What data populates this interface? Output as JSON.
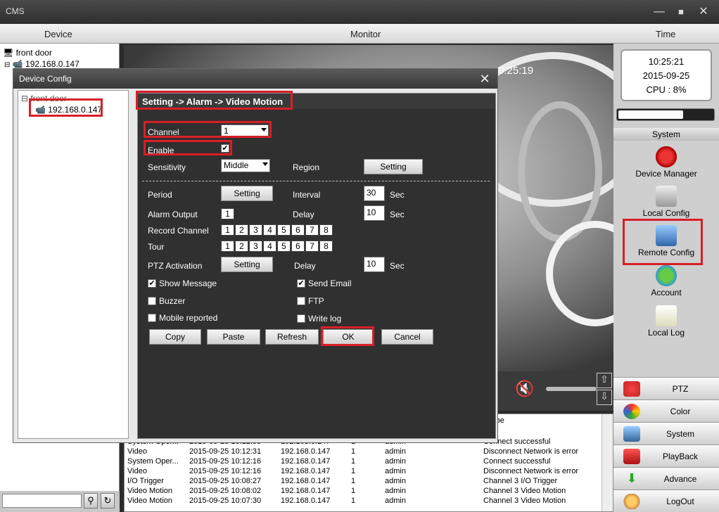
{
  "window": {
    "title": "CMS",
    "minimize": "—",
    "maximize": "■",
    "close": "✕"
  },
  "columns": {
    "device": "Device",
    "monitor": "Monitor",
    "time": "Time"
  },
  "device_tree": {
    "root": "front door",
    "child": "192.168.0.147"
  },
  "video": {
    "timestamp": "0:25:19"
  },
  "clock": {
    "time": "10:25:21",
    "date": "2015-09-25",
    "cpu": "CPU : 8%"
  },
  "system": {
    "header": "System",
    "items": [
      {
        "label": "Device Manager",
        "icon": "device-manager-icon"
      },
      {
        "label": "Local Config",
        "icon": "local-config-icon"
      },
      {
        "label": "Remote Config",
        "icon": "remote-config-icon"
      },
      {
        "label": "Account",
        "icon": "account-icon"
      },
      {
        "label": "Local Log",
        "icon": "local-log-icon"
      }
    ]
  },
  "bottom_menu": [
    {
      "label": "PTZ",
      "icon": "ptz-icon"
    },
    {
      "label": "Color",
      "icon": "color-icon"
    },
    {
      "label": "System",
      "icon": "system-icon"
    },
    {
      "label": "PlayBack",
      "icon": "playback-icon"
    },
    {
      "label": "Advance",
      "icon": "advance-icon"
    },
    {
      "label": "LogOut",
      "icon": "logout-icon"
    }
  ],
  "log": {
    "header_desc": "cribe",
    "rows": [
      [
        "System Oper...",
        "2015-09-25 10:12:55",
        "192.168.0.147",
        "1",
        "admin",
        "Connect successful"
      ],
      [
        "Video",
        "2015-09-25 10:12:31",
        "192.168.0.147",
        "1",
        "admin",
        "Disconnect Network is error"
      ],
      [
        "System Oper...",
        "2015-09-25 10:12:16",
        "192.168.0.147",
        "1",
        "admin",
        "Connect successful"
      ],
      [
        "Video",
        "2015-09-25 10:12:16",
        "192.168.0.147",
        "1",
        "admin",
        "Disconnect Network is error"
      ],
      [
        "I/O Trigger",
        "2015-09-25 10:08:27",
        "192.168.0.147",
        "1",
        "admin",
        "Channel 3 I/O Trigger"
      ],
      [
        "Video Motion",
        "2015-09-25 10:08:02",
        "192.168.0.147",
        "1",
        "admin",
        "Channel 3 Video Motion"
      ],
      [
        "Video Motion",
        "2015-09-25 10:07:30",
        "192.168.0.147",
        "1",
        "admin",
        "Channel 3 Video Motion"
      ]
    ]
  },
  "dialog": {
    "title": "Device Config",
    "close": "✕",
    "tree_root": "front door",
    "tree_child": "192.168.0.147",
    "breadcrumb": "Setting -> Alarm -> Video Motion",
    "channel_label": "Channel",
    "channel_value": "1",
    "enable_label": "Enable",
    "enable_checked": true,
    "sensitivity_label": "Sensitivity",
    "sensitivity_value": "Middle",
    "region_label": "Region",
    "setting_label": "Setting",
    "period_label": "Period",
    "interval_label": "Interval",
    "interval_value": "30",
    "sec": "Sec",
    "alarm_output_label": "Alarm Output",
    "alarm_output_value": "1",
    "delay_label": "Delay",
    "delay_value": "10",
    "record_channel_label": "Record Channel",
    "tour_label": "Tour",
    "channels": [
      "1",
      "2",
      "3",
      "4",
      "5",
      "6",
      "7",
      "8"
    ],
    "ptz_label": "PTZ Activation",
    "ptz_delay_value": "10",
    "show_message": "Show Message",
    "send_email": "Send Email",
    "buzzer": "Buzzer",
    "ftp": "FTP",
    "mobile": "Mobile reported",
    "write_log": "Write log",
    "copy": "Copy",
    "paste": "Paste",
    "refresh": "Refresh",
    "ok": "OK",
    "cancel": "Cancel"
  },
  "search": {
    "placeholder": ""
  },
  "colors": {
    "highlight": "#d81f26",
    "panel": "#303030"
  }
}
